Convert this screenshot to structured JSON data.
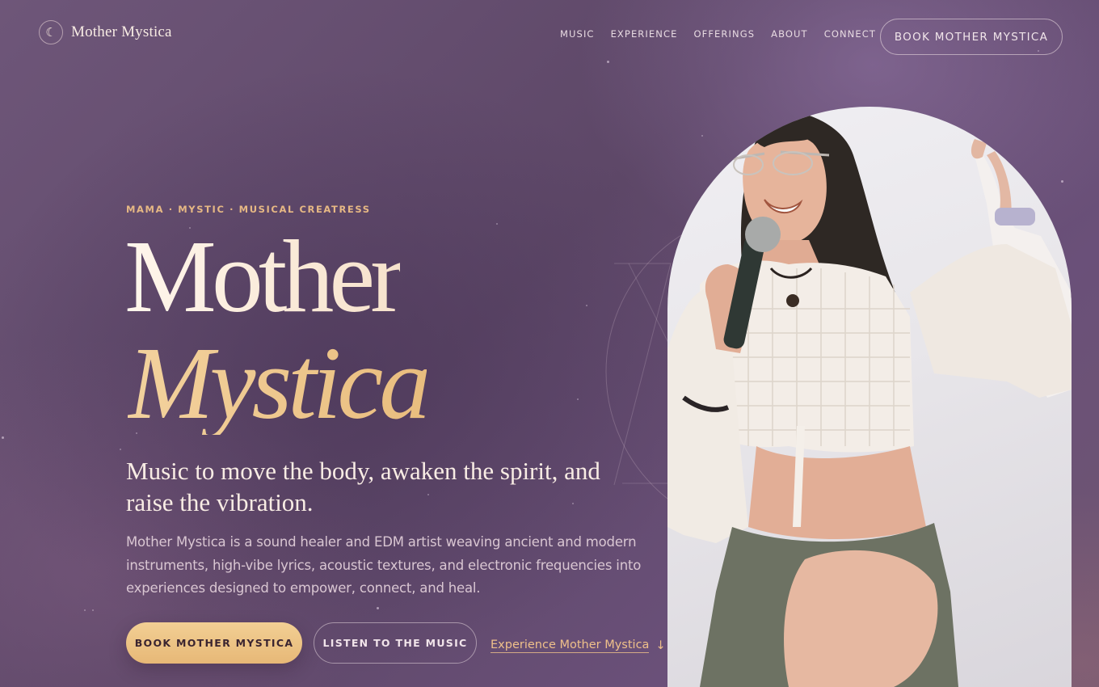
{
  "header": {
    "brand_icon": "crescent-moon-icon",
    "brand_glyph": "☾",
    "brand_name": "Mother Mystica",
    "nav": [
      "MUSIC",
      "EXPERIENCE",
      "OFFERINGS",
      "ABOUT",
      "CONNECT"
    ],
    "cta_label": "BOOK MOTHER MYSTICA"
  },
  "hero": {
    "eyebrow": "MAMA · MYSTIC · MUSICAL CREATRESS",
    "title_line1": "Mother",
    "title_line2": "Mystica",
    "tagline": "Music to move the body, awaken the spirit, and raise the vibration.",
    "description": "Mother Mystica is a sound healer and EDM artist weaving ancient and modern instruments, high-vibe lyrics, acoustic textures, and electronic frequencies into experiences designed to empower, connect, and heal.",
    "primary_button": "BOOK MOTHER MYSTICA",
    "secondary_button": "LISTEN TO THE MUSIC",
    "link_label": "Experience Mother Mystica",
    "link_arrow": "↓"
  },
  "colors": {
    "accent_gold": "#e9bd7e",
    "background": "#5d4767",
    "text_cream": "#fbeee2"
  }
}
